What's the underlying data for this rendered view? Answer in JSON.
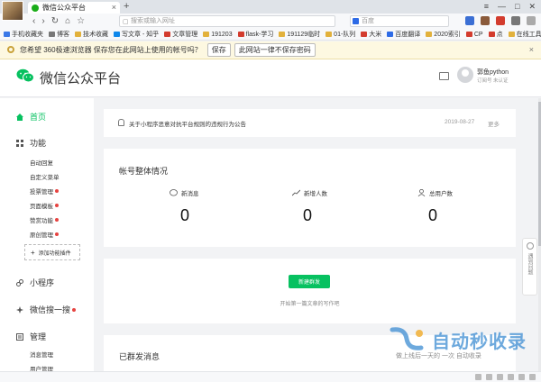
{
  "browser": {
    "tab_title": "微信公众平台",
    "tab_close": "×",
    "new_tab": "+",
    "window_controls": [
      "≡",
      "—",
      "□",
      "✕"
    ],
    "nav": {
      "back": "‹",
      "forward": "›",
      "reload": "↻",
      "home": "⌂",
      "bookmark": "☆"
    },
    "address_placeholder": "搜索或输入网址",
    "search_placeholder": "百度",
    "bookmarks": [
      {
        "label": "手机收藏夹",
        "color": "#3b78e7"
      },
      {
        "label": "博客",
        "color": "#777777"
      },
      {
        "label": "技术收藏",
        "color": "#e2b13c"
      },
      {
        "label": "写文章 - 知乎",
        "color": "#0f88eb"
      },
      {
        "label": "文章管理",
        "color": "#d33c2e"
      },
      {
        "label": "191203",
        "color": "#e2b13c"
      },
      {
        "label": "flask-学习",
        "color": "#d33c2e"
      },
      {
        "label": "191129临时",
        "color": "#e2b13c"
      },
      {
        "label": "01-队列",
        "color": "#e2b13c"
      },
      {
        "label": "大米",
        "color": "#d33c2e"
      },
      {
        "label": "百度翻译",
        "color": "#2e6be6"
      },
      {
        "label": "2020索引",
        "color": "#e2b13c"
      },
      {
        "label": "CP",
        "color": "#d33c2e"
      },
      {
        "label": "点",
        "color": "#d33c2e"
      },
      {
        "label": "在线工具",
        "color": "#e2b13c"
      }
    ]
  },
  "password_bar": {
    "message": "您希望 360极速浏览器 保存您在此网站上使用的帐号吗？",
    "save_label": "保存",
    "never_label": "此网站一律不保存密码",
    "close": "×"
  },
  "header": {
    "title": "微信公众平台",
    "username": "郭鱼python",
    "subtitle": "订阅号  未认证"
  },
  "sidebar": {
    "home": "首页",
    "features": "功能",
    "feature_items": [
      {
        "label": "自动回复",
        "dot": false
      },
      {
        "label": "自定义菜单",
        "dot": false
      },
      {
        "label": "投票管理",
        "dot": true
      },
      {
        "label": "页面模板",
        "dot": true
      },
      {
        "label": "赞赏功能",
        "dot": true
      },
      {
        "label": "原创管理",
        "dot": true
      }
    ],
    "add_plugin": "添加功能插件",
    "miniprogram": "小程序",
    "wechat_search": "微信搜一搜",
    "manage": "管理",
    "manage_items": [
      "消息管理",
      "用户管理"
    ]
  },
  "notice": {
    "text": "关于小程序恶意对抗平台规则的违规行为公告",
    "date": "2019-08-27",
    "more": "更多"
  },
  "overview": {
    "title": "帐号整体情况",
    "stats": [
      {
        "label": "新消息",
        "value": "0"
      },
      {
        "label": "新增人数",
        "value": "0"
      },
      {
        "label": "总用户数",
        "value": "0"
      }
    ]
  },
  "mass": {
    "button": "新建群发",
    "hint": "开始第一篇文章的写作吧"
  },
  "sent": {
    "title": "已群发消息"
  },
  "feedback": {
    "label": "遇到问题"
  },
  "watermark": {
    "main": "自动秒收录",
    "sub": "做上线后一天的   一次   自动收录"
  },
  "colors": {
    "accent": "#07c160",
    "dot": "#e64340"
  }
}
